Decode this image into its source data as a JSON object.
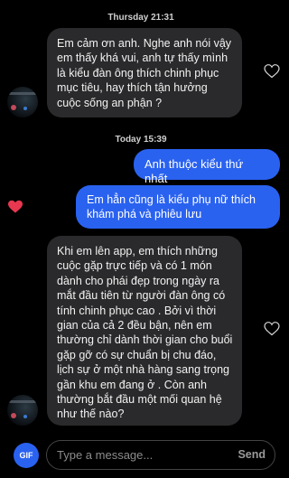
{
  "thread": {
    "date_1": "Thursday 21:31",
    "date_2": "Today 15:39",
    "msg_1": "Em cảm ơn anh. Nghe anh nói vậy em thấy khá vui, anh tự thấy mình là kiểu đàn ông thích chinh phục mục tiêu, hay thích tận hưởng cuộc sống an phận ?",
    "msg_2": "Anh thuộc kiểu thứ nhất",
    "msg_3": "Em hẳn cũng là kiểu phụ nữ thích khám phá và phiêu lưu",
    "msg_4": "Khi em lên app, em thích những cuộc gặp trực tiếp và có 1 món dành cho phái đẹp trong ngày ra mắt đầu tiên từ người đàn ông có tính chinh phục cao . Bởi vì thời gian của cả 2 đều bận, nên em thường chỉ dành thời gian cho buổi gặp gỡ có sự chuẩn bị chu đáo, lịch sự ở một nhà hàng sang trọng gần khu em đang ở . Còn anh thường bắt đầu một mối quan hệ như thế nào?"
  },
  "composer": {
    "gif_label": "GIF",
    "placeholder": "Type a message...",
    "send_label": "Send"
  },
  "colors": {
    "outgoing_bubble": "#2a62f0",
    "incoming_bubble": "#2a2a2c",
    "liked_heart": "#e8384f"
  },
  "icons": [
    "heart-outline-icon",
    "heart-filled-icon",
    "gif-icon"
  ]
}
